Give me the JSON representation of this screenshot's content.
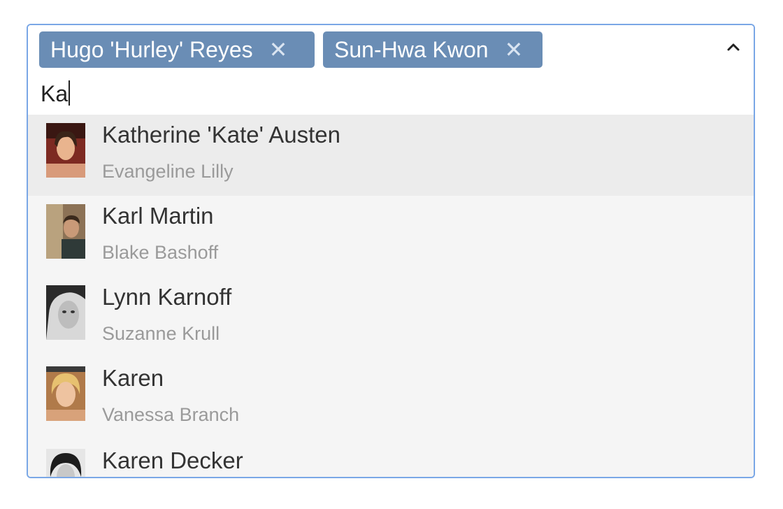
{
  "selected_tags": [
    {
      "label": "Hugo 'Hurley' Reyes",
      "remove_glyph": "✕"
    },
    {
      "label": "Sun-Hwa Kwon",
      "remove_glyph": "✕"
    }
  ],
  "search": {
    "value": "Ka"
  },
  "toggle": {
    "icon": "chevron-up-icon"
  },
  "options": [
    {
      "name": "Katherine 'Kate' Austen",
      "actor": "Evangeline Lilly",
      "focused": true
    },
    {
      "name": "Karl Martin",
      "actor": "Blake Bashoff",
      "focused": false
    },
    {
      "name": "Lynn Karnoff",
      "actor": "Suzanne Krull",
      "focused": false
    },
    {
      "name": "Karen",
      "actor": "Vanessa Branch",
      "focused": false
    },
    {
      "name": "Karen Decker",
      "actor": "",
      "focused": false
    }
  ],
  "colors": {
    "tag_background": "#6a8db5",
    "focus_border": "#7aa7e6",
    "menu_background": "#f5f5f5",
    "focused_option": "#ececec",
    "secondary_text": "#9a9a9a"
  }
}
